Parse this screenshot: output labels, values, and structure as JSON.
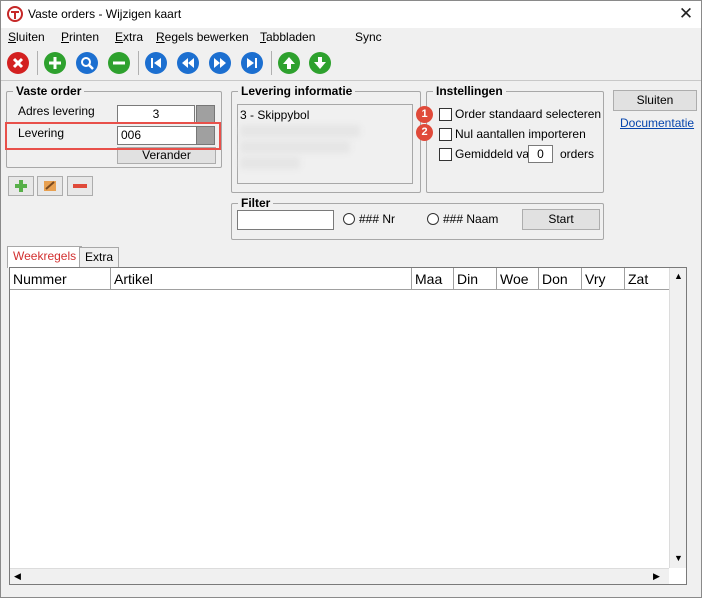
{
  "window": {
    "title": "Vaste orders - Wijzigen kaart",
    "close_glyph": "✕"
  },
  "menu": {
    "sluiten": {
      "first": "S",
      "rest": "luiten"
    },
    "printen": {
      "first": "P",
      "rest": "rinten"
    },
    "extra": {
      "first": "E",
      "rest": "xtra"
    },
    "regels": {
      "first": "R",
      "rest": "egels bewerken"
    },
    "tabbladen": {
      "first": "T",
      "rest": "abbladen"
    },
    "sync": "Sync"
  },
  "toolbar": {
    "icons": [
      "close-red-icon",
      "add-green-icon",
      "search-blue-icon",
      "remove-green-icon",
      "first-icon",
      "previous-icon",
      "next-icon",
      "last-icon",
      "move-up-icon",
      "move-down-icon"
    ]
  },
  "vaste_order": {
    "title": "Vaste order",
    "adres_label": "Adres levering",
    "adres_value": "3",
    "levering_label": "Levering",
    "levering_value": "006",
    "verander_label": "Verander"
  },
  "levering_info": {
    "title": "Levering informatie",
    "line1": "3 - Skippybol"
  },
  "instellingen": {
    "title": "Instellingen",
    "opt1_label": "Order standaard selecteren",
    "opt2_label": "Nul aantallen importeren",
    "opt3_label": "Gemiddeld van",
    "opt3_value": "0",
    "opt3_suffix": "orders",
    "badge1": "1",
    "badge2": "2"
  },
  "side": {
    "sluiten_label": "Sluiten",
    "doc_link": "Documentatie"
  },
  "filter": {
    "title": "Filter",
    "input_value": "",
    "radio_nr": "### Nr",
    "radio_naam": "### Naam",
    "start_label": "Start"
  },
  "tabs": {
    "weekregels": "Weekregels",
    "extra": "Extra"
  },
  "grid": {
    "columns": [
      "Nummer",
      "Artikel",
      "Maa",
      "Din",
      "Woe",
      "Don",
      "Vry",
      "Zat"
    ]
  },
  "colors": {
    "active_tab_text": "#d23030",
    "link": "#0645ad",
    "highlight": "#e8504a"
  }
}
